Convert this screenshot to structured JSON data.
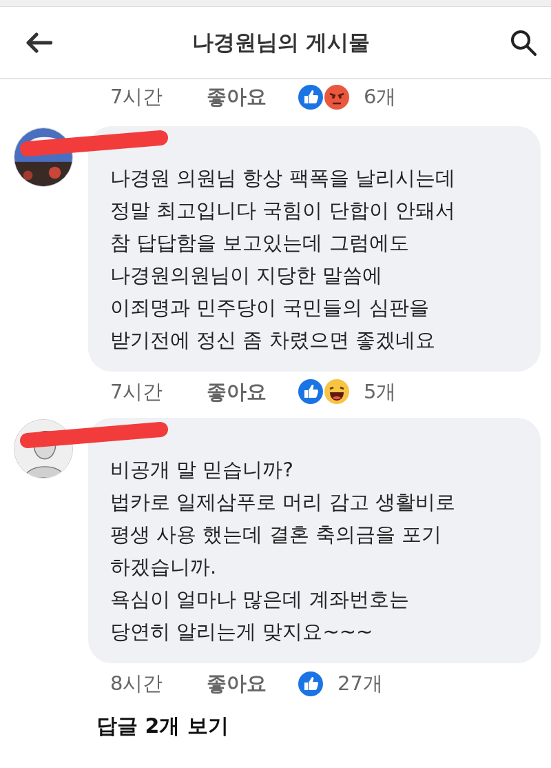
{
  "header": {
    "title": "나경원님의 게시물"
  },
  "top_meta": {
    "time": "7시간",
    "like_label": "좋아요",
    "reactions": [
      {
        "kind": "like"
      },
      {
        "kind": "angry"
      }
    ],
    "count": "6개"
  },
  "comments": [
    {
      "redacted": true,
      "lines": [
        "나경원 의원님 항상 팩폭을 날리시는데",
        "정말 최고입니다 국힘이 단합이 안돼서",
        "참 답답함을 보고있는데 그럼에도",
        "나경원의원님이 지당한 말씀에",
        "이죄명과 민주당이 국민들의 심판을",
        "받기전에 정신 좀 차렸으면 좋겠네요"
      ],
      "time": "7시간",
      "like_label": "좋아요",
      "reactions": [
        {
          "kind": "like"
        },
        {
          "kind": "haha"
        }
      ],
      "count": "5개"
    },
    {
      "redacted": true,
      "lines": [
        "비공개 말 믿습니까?",
        "법카로 일제삼푸로 머리 감고 생활비로",
        "평생 사용 했는데 결혼 축의금을 포기",
        "하겠습니까.",
        "욕심이 얼마나 많은데 계좌번호는",
        "당연히 알리는게 맞지요~~~"
      ],
      "time": "8시간",
      "like_label": "좋아요",
      "reactions": [
        {
          "kind": "like"
        }
      ],
      "count": "27개"
    }
  ],
  "replies_link": "답글 2개 보기"
}
